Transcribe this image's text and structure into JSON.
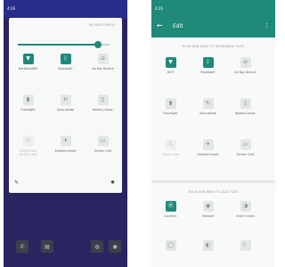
{
  "left": {
    "status_time": "4:26",
    "brightness_label": "NO BRIGHTNESS",
    "brightness_level": 0.87,
    "tiles": [
      {
        "label": "NetWork/Wifi",
        "icon": "wifi-icon",
        "glyph": "▼",
        "state": "on"
      },
      {
        "label": "Bluetooth",
        "icon": "bluetooth-icon",
        "glyph": "ᛒ",
        "state": "on"
      },
      {
        "label": "Do Not Disturb",
        "icon": "do-not-disturb-icon",
        "glyph": "⊖",
        "state": "off"
      },
      {
        "label": "Flashlight",
        "icon": "flashlight-icon",
        "glyph": "▮",
        "state": "off"
      },
      {
        "label": "Auto-rotate",
        "icon": "rotate-icon",
        "glyph": "↻",
        "state": "off"
      },
      {
        "label": "Battery Saver",
        "icon": "battery-icon",
        "glyph": "▯",
        "state": "off"
      },
      {
        "label": "Mobile data\nNo SIM card",
        "icon": "mobile-data-icon",
        "glyph": "⇅",
        "state": "disabled"
      },
      {
        "label": "Airplane mode",
        "icon": "airplane-icon",
        "glyph": "✈",
        "state": "off"
      },
      {
        "label": "Screen Cast",
        "icon": "cast-icon",
        "glyph": "▭",
        "state": "off"
      }
    ]
  },
  "right": {
    "status_time": "4:26",
    "title": "Edit",
    "section1_header": "HOLD AND DRAG TO REARRANGE TILES",
    "section2_header": "HOLD AND DRAG TO ADD TILES",
    "tiles": [
      {
        "label": "Wi-Fi",
        "icon": "wifi-icon",
        "glyph": "▼",
        "state": "on"
      },
      {
        "label": "Bluetooth",
        "icon": "bluetooth-icon",
        "glyph": "ᛒ",
        "state": "on"
      },
      {
        "label": "Do Not Disturb",
        "icon": "do-not-disturb-icon",
        "glyph": "⊖",
        "state": "off"
      },
      {
        "label": "Flashlight",
        "icon": "flashlight-icon",
        "glyph": "▮",
        "state": "off"
      },
      {
        "label": "Auto-rotate",
        "icon": "rotate-icon",
        "glyph": "↻",
        "state": "off"
      },
      {
        "label": "Battery Saver",
        "icon": "battery-icon",
        "glyph": "▯",
        "state": "off"
      },
      {
        "label": "Mobile data",
        "icon": "mobile-data-icon",
        "glyph": "⇅",
        "state": "disabled"
      },
      {
        "label": "Airplane mode",
        "icon": "airplane-icon",
        "glyph": "✈",
        "state": "off"
      },
      {
        "label": "Screen Cast",
        "icon": "cast-icon",
        "glyph": "▭",
        "state": "off"
      }
    ],
    "add_tiles": [
      {
        "label": "Location",
        "icon": "location-icon",
        "glyph": "⦿",
        "state": "on"
      },
      {
        "label": "Hotspot",
        "icon": "hotspot-icon",
        "glyph": "◉",
        "state": "off"
      },
      {
        "label": "Invert colors",
        "icon": "invert-colors-icon",
        "glyph": "◑",
        "state": "off"
      },
      {
        "label": "",
        "icon": "data-saver-icon",
        "glyph": "◯",
        "state": "off"
      },
      {
        "label": "",
        "icon": "contrast-icon",
        "glyph": "◐",
        "state": "off"
      },
      {
        "label": "",
        "icon": "night-icon",
        "glyph": "☾",
        "state": "off"
      }
    ]
  },
  "dock": [
    {
      "icon": "phone-app-icon",
      "glyph": "✆"
    },
    {
      "icon": "messages-app-icon",
      "glyph": "▤"
    },
    {
      "icon": "browser-app-icon",
      "glyph": "◍"
    },
    {
      "icon": "camera-app-icon",
      "glyph": "◉"
    }
  ],
  "colors": {
    "accent": "#1f8a78",
    "status_left": "#2a2c8a",
    "wallpaper": "#2a2460"
  }
}
